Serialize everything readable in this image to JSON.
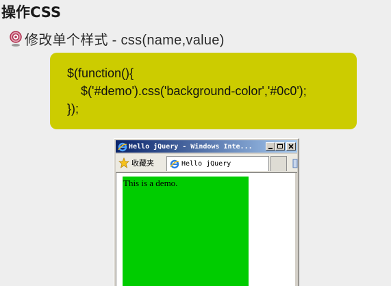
{
  "slide": {
    "title": "操作CSS",
    "subhead": "修改单个样式 -  css(name,value)"
  },
  "code": {
    "lines": [
      "$(function(){",
      "    $('#demo').css('background-color','#0c0');",
      "});"
    ],
    "box_color": "#cccc00"
  },
  "browser": {
    "window_title": "Hello jQuery - Windows Inte...",
    "favorites_label": "收藏夹",
    "tab_title": "Hello jQuery",
    "demo_text": "This is a demo.",
    "demo_color": "#00cc00",
    "icons": {
      "bullet": "bullet-target-icon",
      "ie": "ie-logo-icon",
      "favorites": "star-icon",
      "minimize": "minimize-icon",
      "maximize": "maximize-icon",
      "close": "close-icon"
    }
  }
}
